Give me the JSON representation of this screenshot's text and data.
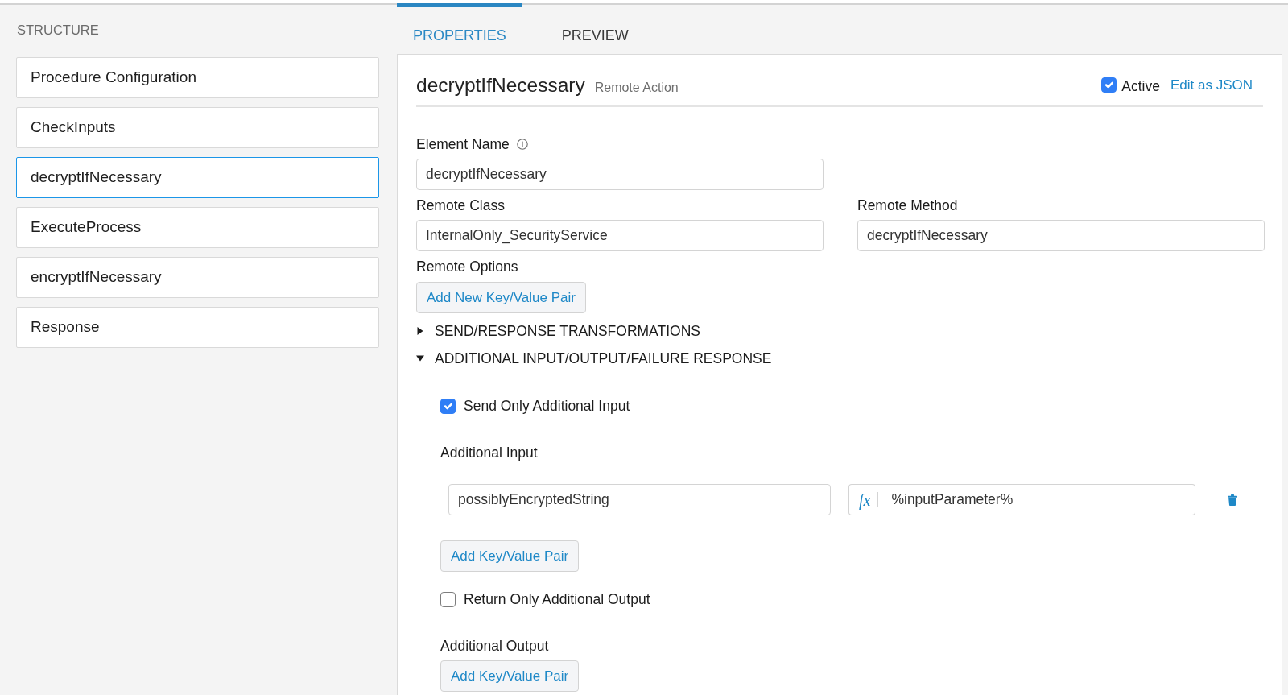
{
  "structure": {
    "title": "STRUCTURE",
    "items": [
      {
        "label": "Procedure Configuration",
        "selected": false
      },
      {
        "label": "CheckInputs",
        "selected": false
      },
      {
        "label": "decryptIfNecessary",
        "selected": true
      },
      {
        "label": "ExecuteProcess",
        "selected": false
      },
      {
        "label": "encryptIfNecessary",
        "selected": false
      },
      {
        "label": "Response",
        "selected": false
      }
    ]
  },
  "tabs": [
    {
      "label": "PROPERTIES",
      "selected": true
    },
    {
      "label": "PREVIEW",
      "selected": false
    }
  ],
  "element": {
    "title": "decryptIfNecessary",
    "type": "Remote Action",
    "active": {
      "label": "Active",
      "checked": true
    },
    "edit_link": "Edit as JSON",
    "element_name": {
      "label": "Element Name",
      "value": "decryptIfNecessary"
    },
    "remote_class": {
      "label": "Remote Class",
      "value": "InternalOnly_SecurityService"
    },
    "remote_method": {
      "label": "Remote Method",
      "value": "decryptIfNecessary"
    },
    "remote_options": {
      "label": "Remote Options",
      "button": "Add New Key/Value Pair"
    },
    "sections": [
      {
        "title": "SEND/RESPONSE TRANSFORMATIONS",
        "expanded": false
      },
      {
        "title": "ADDITIONAL INPUT/OUTPUT/FAILURE RESPONSE",
        "expanded": true,
        "send_only_additional_input": {
          "label": "Send Only Additional Input",
          "checked": true
        },
        "additional_input": {
          "label": "Additional Input",
          "pairs": [
            {
              "key": "possiblyEncryptedString",
              "formula_sign": "fx",
              "value": "%inputParameter%"
            }
          ],
          "button": "Add Key/Value Pair"
        },
        "return_only_additional_output": {
          "label": "Return Only Additional Output",
          "checked": false
        },
        "additional_output": {
          "label": "Additional Output",
          "button": "Add Key/Value Pair"
        }
      }
    ]
  }
}
